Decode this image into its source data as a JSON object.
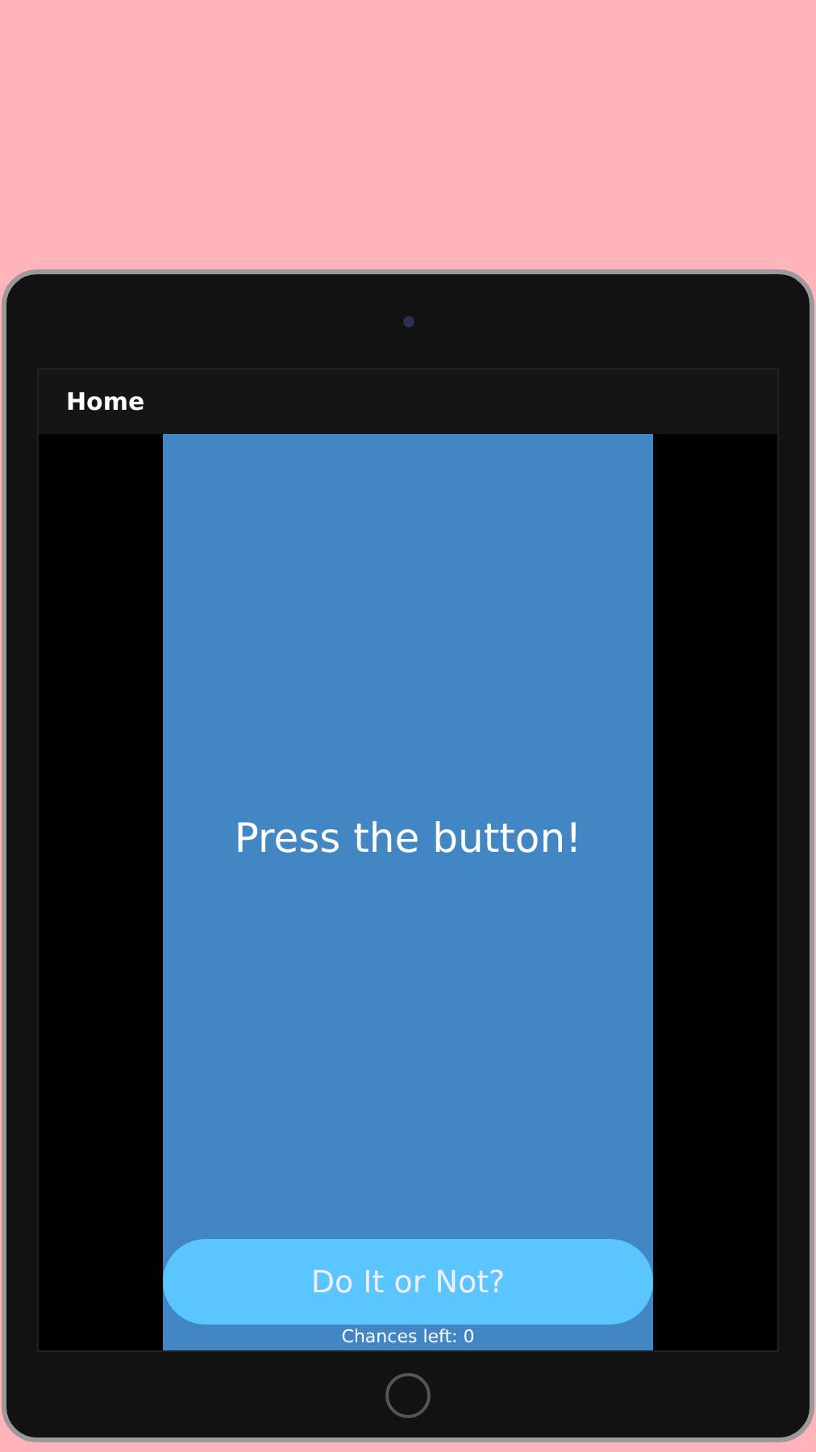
{
  "app_bar": {
    "title": "Home"
  },
  "content": {
    "message": "Press the button!",
    "button": "Do It or Not?",
    "chances": "Chances left: 0"
  }
}
